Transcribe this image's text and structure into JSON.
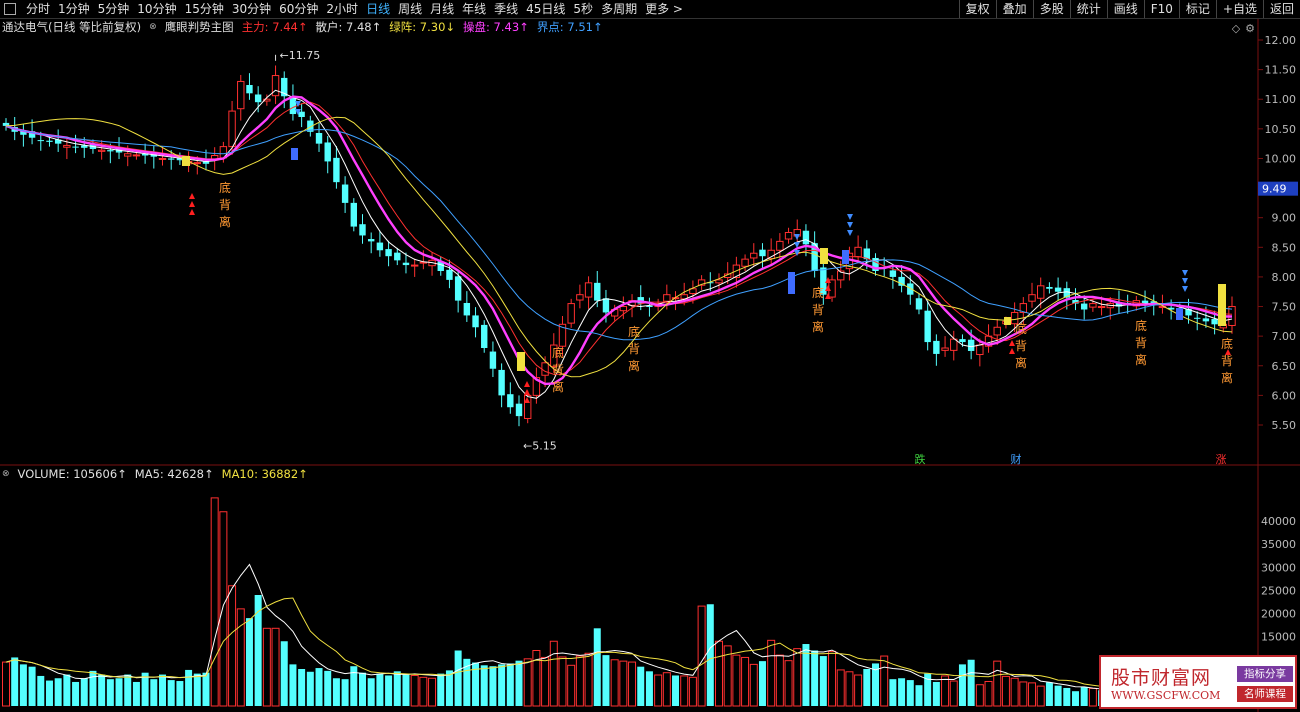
{
  "toolbar": {
    "periods": [
      "分时",
      "1分钟",
      "5分钟",
      "10分钟",
      "15分钟",
      "30分钟",
      "60分钟",
      "2小时",
      "日线",
      "周线",
      "月线",
      "年线",
      "季线",
      "45日线",
      "5秒",
      "多周期",
      "更多"
    ],
    "active_period": "日线",
    "right_buttons": [
      "复权",
      "叠加",
      "多股",
      "统计",
      "画线",
      "F10",
      "标记",
      "+自选",
      "返回"
    ]
  },
  "price_header": {
    "title": "通达电气(日线 等比前复权)",
    "indicator": "鹰眼判势主图",
    "items": [
      {
        "label": "主力: 7.44",
        "arrow": "↑",
        "color": "#ff3030"
      },
      {
        "label": "散户: 7.48",
        "arrow": "↑",
        "color": "#e0e0e0"
      },
      {
        "label": "绿阵: 7.30",
        "arrow": "↓",
        "color": "#f0e040"
      },
      {
        "label": "操盘: 7.43",
        "arrow": "↑",
        "color": "#ff40ff"
      },
      {
        "label": "界点: 7.51",
        "arrow": "↑",
        "color": "#40a0ff"
      }
    ]
  },
  "vol_header": {
    "items": [
      {
        "label": "VOLUME: 105606",
        "arrow": "↑",
        "color": "#e0e0e0"
      },
      {
        "label": "MA5: 42628",
        "arrow": "↑",
        "color": "#e0e0e0"
      },
      {
        "label": "MA10: 36882",
        "arrow": "↑",
        "color": "#f0e040"
      }
    ]
  },
  "price_axis": [
    "12.00",
    "11.50",
    "11.00",
    "10.50",
    "10.00",
    "9.50",
    "9.00",
    "8.50",
    "8.00",
    "7.50",
    "7.00",
    "6.50",
    "6.00",
    "5.50"
  ],
  "current_price": "9.49",
  "vol_axis": [
    "40000",
    "35000",
    "30000",
    "25000",
    "20000",
    "15000"
  ],
  "annotations": {
    "high": "11.75",
    "low": "5.15",
    "divergence_chars": [
      "底",
      "背",
      "离"
    ],
    "signals": [
      {
        "text": "跌",
        "color": "#3fd23f"
      },
      {
        "text": "财",
        "color": "#40a0ff"
      },
      {
        "text": "涨",
        "color": "#ff3030"
      }
    ]
  },
  "chart_data": {
    "type": "candlestick",
    "ylim": [
      5.15,
      12.0
    ],
    "x": [],
    "close_series_note": "",
    "closes": [
      10.55,
      10.45,
      10.4,
      10.35,
      10.3,
      10.28,
      10.25,
      10.22,
      10.2,
      10.18,
      10.16,
      10.14,
      10.12,
      10.1,
      10.08,
      10.06,
      10.05,
      10.03,
      10.0,
      9.98,
      9.97,
      9.95,
      9.93,
      9.91,
      10.05,
      10.2,
      10.8,
      11.3,
      11.1,
      10.95,
      11.0,
      11.4,
      11.05,
      10.75,
      10.7,
      10.45,
      10.25,
      9.95,
      9.6,
      9.25,
      8.85,
      8.7,
      8.6,
      8.45,
      8.35,
      8.28,
      8.2,
      8.2,
      8.25,
      8.28,
      8.1,
      7.95,
      7.6,
      7.35,
      7.15,
      6.8,
      6.45,
      6.0,
      5.8,
      5.65,
      6.0,
      6.3,
      6.55,
      6.85,
      7.2,
      7.55,
      7.7,
      7.9,
      7.6,
      7.4,
      7.45,
      7.5,
      7.6,
      7.55,
      7.5,
      7.55,
      7.7,
      7.65,
      7.7,
      7.8,
      7.95,
      7.9,
      7.95,
      8.05,
      8.2,
      8.3,
      8.4,
      8.35,
      8.45,
      8.6,
      8.75,
      8.8,
      8.55,
      8.1,
      7.7,
      7.95,
      8.1,
      8.4,
      8.5,
      8.3,
      8.1,
      8.15,
      8.0,
      7.85,
      7.7,
      7.45,
      6.9,
      6.7,
      6.8,
      6.95,
      6.9,
      6.75,
      6.85,
      7.0,
      7.15,
      7.25,
      7.4,
      7.55,
      7.7,
      7.85,
      7.8,
      7.75,
      7.65,
      7.55,
      7.45,
      7.55,
      7.5,
      7.55,
      7.5,
      7.55,
      7.6,
      7.55,
      7.55,
      7.5,
      7.45,
      7.4,
      7.35,
      7.3,
      7.25,
      7.2,
      7.2,
      7.5
    ],
    "volumes": [
      9500,
      10500,
      9000,
      8500,
      6500,
      5500,
      6000,
      6800,
      5200,
      6000,
      7600,
      6800,
      5800,
      6000,
      6800,
      5200,
      7200,
      5800,
      6800,
      5600,
      5400,
      7800,
      7000,
      7200,
      45000,
      42000,
      26000,
      21000,
      19000,
      24000,
      16800,
      16800,
      14000,
      9000,
      8000,
      7400,
      8200,
      7600,
      6000,
      5800,
      8600,
      7200,
      6000,
      7000,
      6600,
      7500,
      7000,
      6600,
      6200,
      6000,
      7000,
      7700,
      12000,
      10200,
      9400,
      8800,
      8600,
      9000,
      9200,
      9800,
      10200,
      12000,
      10500,
      14000,
      10600,
      8800,
      10800,
      11400,
      16800,
      11000,
      10000,
      9700,
      9500,
      8500,
      7500,
      6700,
      7200,
      6600,
      6500,
      6200,
      21600,
      22000,
      14000,
      13000,
      11000,
      10500,
      9000,
      9700,
      14200,
      11000,
      9800,
      12400,
      13400,
      12000,
      10800,
      11800,
      7800,
      7400,
      6700,
      8000,
      9200,
      10800,
      5800,
      6000,
      5600,
      4500,
      7000,
      5200,
      6500,
      5400,
      9000,
      10000,
      4600,
      5300,
      9700,
      6400,
      6000,
      5200,
      5000,
      4300,
      5100,
      4400,
      3900,
      3200,
      4100,
      3800,
      3400,
      3200,
      3100,
      2800,
      2200,
      2400,
      2000,
      2600,
      2000,
      1900,
      1800,
      2200,
      2100,
      2000,
      2400,
      1800,
      3200
    ],
    "volume_ylim": [
      0,
      48000
    ]
  }
}
